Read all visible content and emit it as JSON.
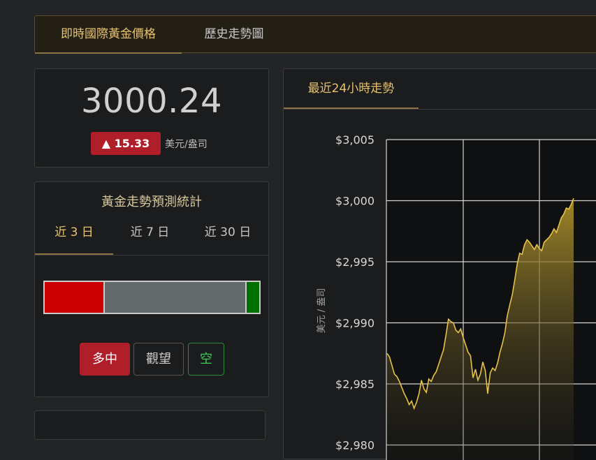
{
  "nav": {
    "tabs": [
      {
        "label": "即時國際黃金價格",
        "active": true
      },
      {
        "label": "歷史走勢圖",
        "active": false
      }
    ]
  },
  "price": {
    "value": "3000.24",
    "change": "▲ 15.33",
    "unit": "美元/盎司"
  },
  "prediction": {
    "title": "黃金走勢預測統計",
    "tabs": [
      {
        "label": "近 3 日",
        "active": true
      },
      {
        "label": "近 7 日",
        "active": false
      },
      {
        "label": "近 30 日",
        "active": false
      }
    ],
    "bar": [
      {
        "name": "bull",
        "fraction": 0.275,
        "color": "#cc0000"
      },
      {
        "name": "neutral",
        "fraction": 0.665,
        "color": "#626a6c"
      },
      {
        "name": "bear",
        "fraction": 0.06,
        "color": "#007000"
      }
    ],
    "buttons": {
      "bull": "多中",
      "watch": "觀望",
      "bear": "空"
    }
  },
  "chart": {
    "tab": "最近24小時走勢"
  },
  "colors": {
    "accent_gold": "#e8c270",
    "line_gold": "#e6c24a",
    "red": "#b01e2a",
    "green": "#2e8a3d"
  },
  "chart_data": {
    "type": "area",
    "title": "",
    "xlabel": "",
    "ylabel": "美元 / 盎司",
    "ylim": [
      2980,
      3005
    ],
    "y_ticks": [
      3005,
      3000,
      2995,
      2990,
      2985,
      2980
    ],
    "y_tick_labels": [
      "$3,005",
      "$3,000",
      "$2,995",
      "$2,990",
      "$2,985",
      "$2,980"
    ],
    "grid": true,
    "x": [
      0,
      1,
      2,
      3,
      4,
      5,
      6,
      7,
      8,
      9,
      10,
      11,
      12,
      13,
      14,
      15,
      16,
      17,
      18,
      19,
      20,
      21,
      22,
      23,
      24,
      25,
      26,
      27,
      28,
      29,
      30,
      31,
      32,
      33,
      34,
      35,
      36,
      37,
      38,
      39,
      40,
      41,
      42,
      43,
      44,
      45,
      46,
      47,
      48,
      49,
      50,
      51,
      52,
      53,
      54,
      55,
      56,
      57,
      58,
      59,
      60,
      61,
      62,
      63,
      64,
      65,
      66,
      67,
      68,
      69,
      70,
      71,
      72,
      73,
      74,
      75,
      76
    ],
    "values": [
      2987.5,
      2987.2,
      2986.5,
      2985.8,
      2985.6,
      2985.2,
      2984.7,
      2984.2,
      2983.8,
      2983.3,
      2983.6,
      2983.0,
      2983.5,
      2984.2,
      2985.3,
      2984.6,
      2984.3,
      2985.4,
      2985.2,
      2985.7,
      2986.0,
      2986.6,
      2987.2,
      2987.8,
      2989.0,
      2990.3,
      2990.1,
      2990.0,
      2989.4,
      2989.2,
      2989.5,
      2988.8,
      2988.2,
      2987.6,
      2987.3,
      2985.5,
      2986.2,
      2985.3,
      2985.8,
      2986.8,
      2986.1,
      2984.2,
      2985.9,
      2986.3,
      2986.1,
      2986.7,
      2987.6,
      2988.3,
      2989.2,
      2990.6,
      2991.5,
      2992.3,
      2993.5,
      2994.8,
      2995.7,
      2995.6,
      2996.4,
      2996.8,
      2996.6,
      2996.3,
      2996.0,
      2996.4,
      2996.1,
      2995.9,
      2996.6,
      2996.8,
      2997.0,
      2997.3,
      2997.7,
      2997.4,
      2998.0,
      2998.6,
      2998.9,
      2999.4,
      2999.3,
      2999.7,
      3000.2
    ]
  }
}
